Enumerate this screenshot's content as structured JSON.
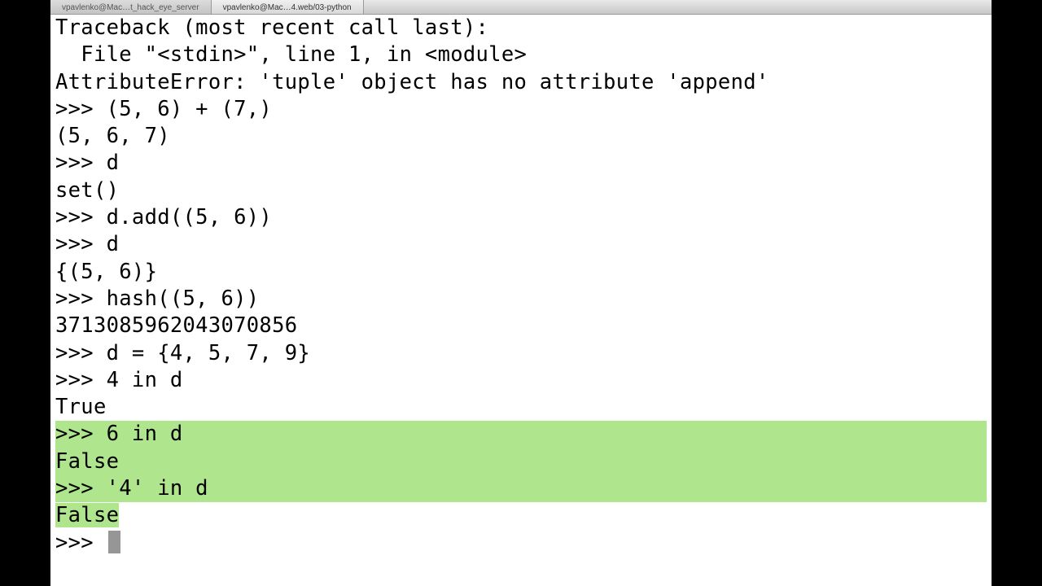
{
  "tabs": [
    {
      "label": "vpavlenko@Mac…t_hack_eye_server",
      "active": false
    },
    {
      "label": "vpavlenko@Mac…4.web/03-python",
      "active": true
    }
  ],
  "terminal": {
    "lines": [
      {
        "text": "Traceback (most recent call last):",
        "hl": "none"
      },
      {
        "text": "  File \"<stdin>\", line 1, in <module>",
        "hl": "none"
      },
      {
        "text": "AttributeError: 'tuple' object has no attribute 'append'",
        "hl": "none"
      },
      {
        "text": ">>> (5, 6) + (7,)",
        "hl": "none"
      },
      {
        "text": "(5, 6, 7)",
        "hl": "none"
      },
      {
        "text": ">>> d",
        "hl": "none"
      },
      {
        "text": "set()",
        "hl": "none"
      },
      {
        "text": ">>> d.add((5, 6))",
        "hl": "none"
      },
      {
        "text": ">>> d",
        "hl": "none"
      },
      {
        "text": "{(5, 6)}",
        "hl": "none"
      },
      {
        "text": ">>> hash((5, 6))",
        "hl": "none"
      },
      {
        "text": "3713085962043070856",
        "hl": "none"
      },
      {
        "text": ">>> d = {4, 5, 7, 9}",
        "hl": "none"
      },
      {
        "text": ">>> 4 in d",
        "hl": "none"
      },
      {
        "text": "True",
        "hl": "none"
      },
      {
        "text": ">>> 6 in d",
        "hl": "full"
      },
      {
        "text": "False",
        "hl": "full"
      },
      {
        "text": ">>> '4' in d",
        "hl": "full"
      },
      {
        "text": "False",
        "hl": "partial"
      },
      {
        "text": ">>> ",
        "hl": "cursor"
      }
    ]
  }
}
